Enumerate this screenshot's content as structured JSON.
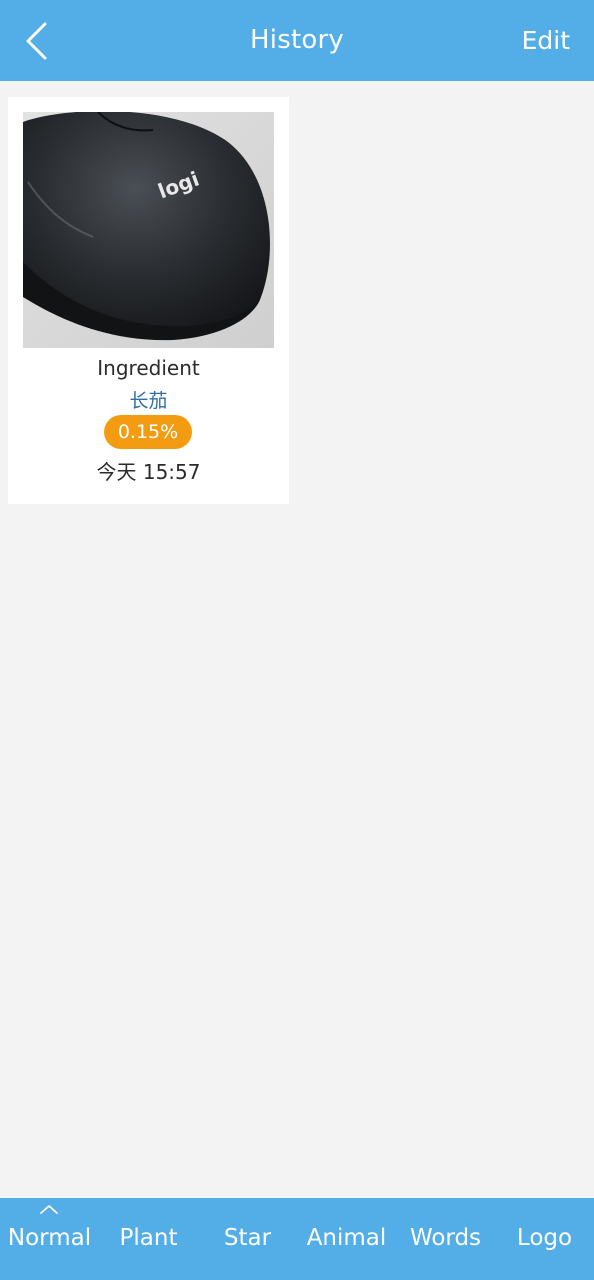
{
  "header": {
    "title": "History",
    "edit_label": "Edit"
  },
  "history": {
    "items": [
      {
        "title": "Ingredient",
        "subtitle": "长茄",
        "confidence": "0.15%",
        "time": "今天 15:57"
      }
    ]
  },
  "tabs": [
    {
      "label": "Normal",
      "active": true
    },
    {
      "label": "Plant"
    },
    {
      "label": "Star"
    },
    {
      "label": "Animal"
    },
    {
      "label": "Words"
    },
    {
      "label": "Logo"
    }
  ],
  "colors": {
    "header_bg": "#53ade6",
    "page_bg": "#f3f3f3",
    "badge_bg": "#f39c12",
    "subtitle_text": "#2f6fa6"
  },
  "icons": {
    "back": "chevron-left-icon",
    "active_tab": "chevron-up-icon"
  }
}
